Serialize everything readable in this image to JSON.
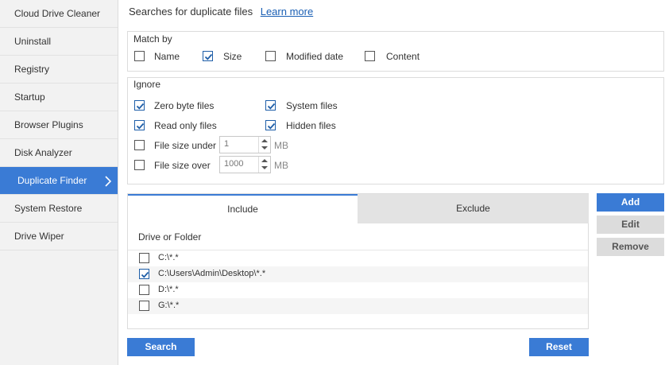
{
  "sidebar": {
    "items": [
      {
        "label": "Cloud Drive Cleaner"
      },
      {
        "label": "Uninstall"
      },
      {
        "label": "Registry"
      },
      {
        "label": "Startup"
      },
      {
        "label": "Browser Plugins"
      },
      {
        "label": "Disk Analyzer"
      },
      {
        "label": "Duplicate Finder",
        "active": true
      },
      {
        "label": "System Restore"
      },
      {
        "label": "Drive Wiper"
      }
    ]
  },
  "header": {
    "text": "Searches for duplicate files",
    "link": "Learn more"
  },
  "match_by": {
    "title": "Match by",
    "options": [
      {
        "label": "Name",
        "checked": false
      },
      {
        "label": "Size",
        "checked": true
      },
      {
        "label": "Modified date",
        "checked": false
      },
      {
        "label": "Content",
        "checked": false
      }
    ]
  },
  "ignore": {
    "title": "Ignore",
    "zero_byte": {
      "label": "Zero byte files",
      "checked": true
    },
    "system": {
      "label": "System files",
      "checked": true
    },
    "read_only": {
      "label": "Read only files",
      "checked": true
    },
    "hidden": {
      "label": "Hidden files",
      "checked": true
    },
    "size_under": {
      "label": "File size under",
      "checked": false,
      "value": "1",
      "unit": "MB"
    },
    "size_over": {
      "label": "File size over",
      "checked": false,
      "value": "1000",
      "unit": "MB"
    }
  },
  "tabs": {
    "include": "Include",
    "exclude": "Exclude"
  },
  "folder_list": {
    "header": "Drive or Folder",
    "rows": [
      {
        "path": "C:\\*.*",
        "checked": false
      },
      {
        "path": "C:\\Users\\Admin\\Desktop\\*.*",
        "checked": true
      },
      {
        "path": "D:\\*.*",
        "checked": false
      },
      {
        "path": "G:\\*.*",
        "checked": false
      }
    ]
  },
  "buttons": {
    "add": "Add",
    "edit": "Edit",
    "remove": "Remove",
    "search": "Search",
    "reset": "Reset"
  },
  "colors": {
    "accent": "#3a7bd5",
    "link": "#1a5fb4"
  },
  "icons": {
    "sidebar_active": "chevron-right-icon",
    "checkbox": "checkmark-icon"
  }
}
